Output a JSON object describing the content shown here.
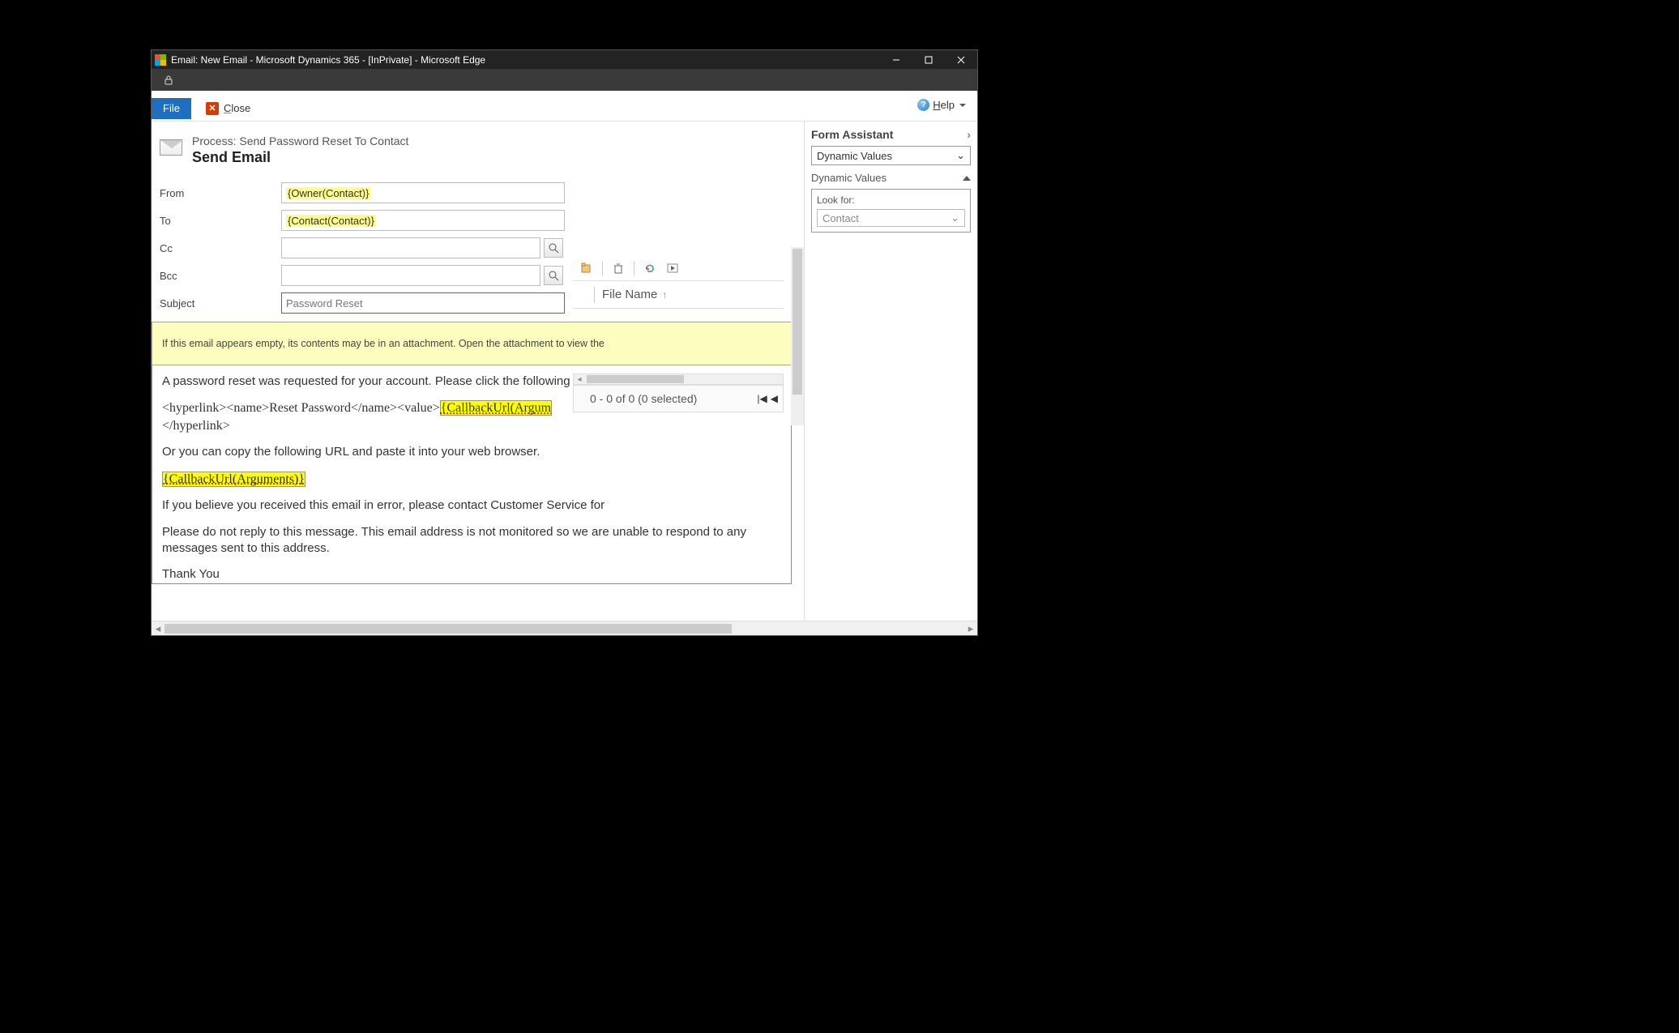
{
  "window": {
    "title": "Email: New Email - Microsoft Dynamics 365 - [InPrivate] - Microsoft Edge"
  },
  "commandbar": {
    "file": "File",
    "close": "Close",
    "help": "Help"
  },
  "header": {
    "process_line": "Process: Send Password Reset To Contact",
    "form_title": "Send Email"
  },
  "fields": {
    "from_label": "From",
    "from_value": "{Owner(Contact)}",
    "to_label": "To",
    "to_value": "{Contact(Contact)}",
    "cc_label": "Cc",
    "bcc_label": "Bcc",
    "subject_label": "Subject",
    "subject_value": "Password Reset"
  },
  "notice": "If this email appears empty, its contents may be in an attachment. Open the attachment to view the",
  "body": {
    "p1": "A password reset was requested for your account. Please click the following link to complete the process.",
    "hl_pre": "<hyperlink><name>Reset Password</name><value>",
    "hl_token": "{CallbackUrl(Argum",
    "hl_close": "</hyperlink>",
    "p3": "Or you can copy the following URL and paste it into your web browser.",
    "cb_token": "{CallbackUrl(Arguments)}",
    "p5": "If you believe you received this email in error, please contact Customer Service for assistance.",
    "p6": "Please do not reply to this message. This email address is not monitored so we are unable to respond to any messages sent to this address.",
    "p7": "Thank You"
  },
  "attachments": {
    "filename_col": "File Name",
    "status": "0 - 0 of 0 (0 selected)"
  },
  "assistant": {
    "title": "Form Assistant",
    "select_value": "Dynamic Values",
    "section_title": "Dynamic Values",
    "lookfor_label": "Look for:",
    "lookfor_value": "Contact"
  }
}
